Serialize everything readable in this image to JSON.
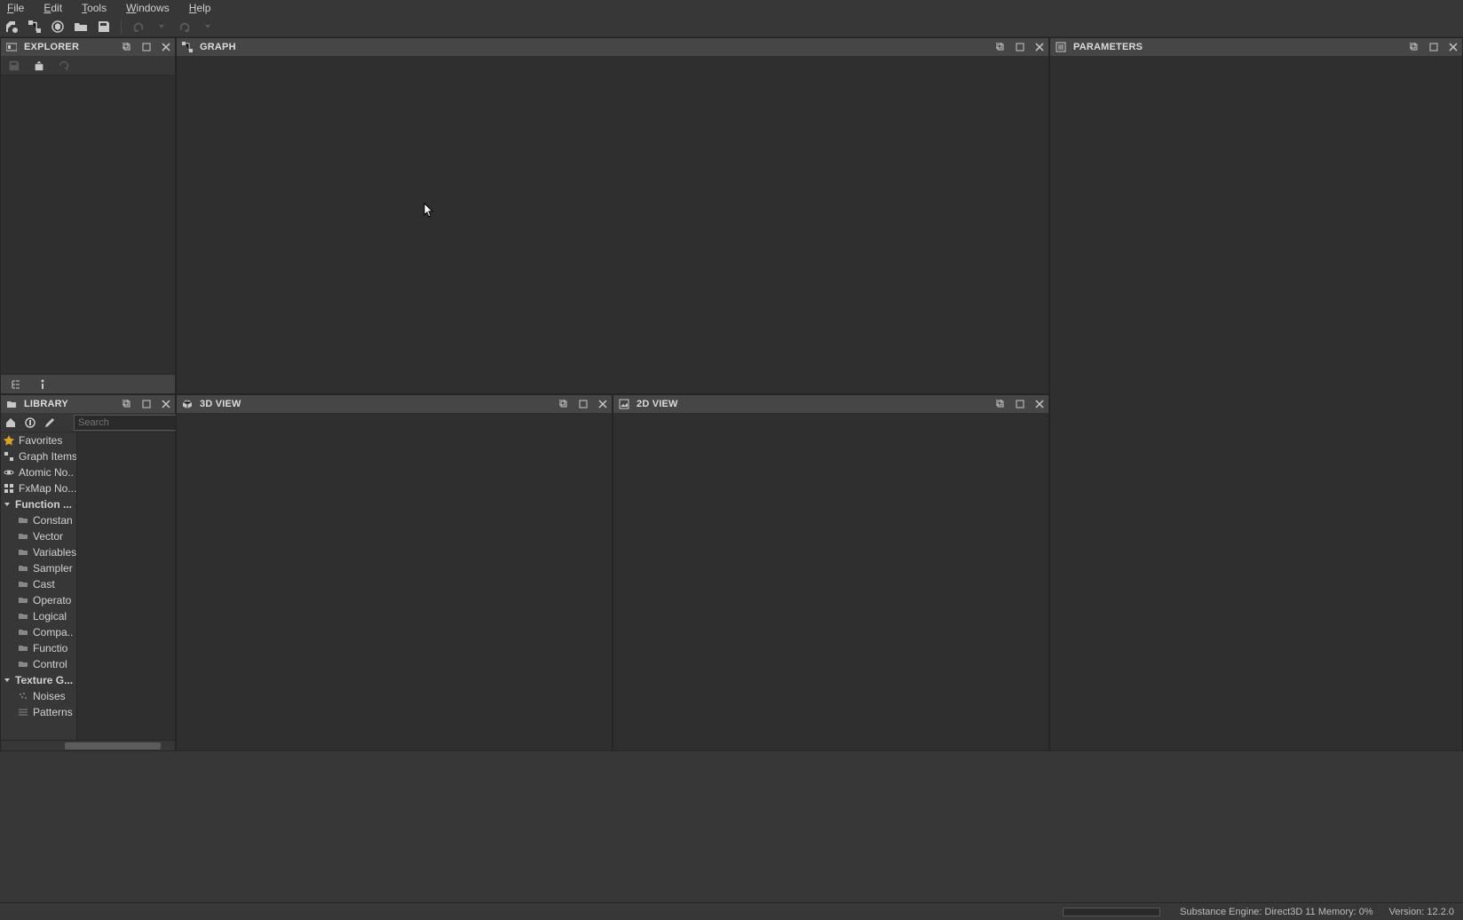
{
  "menubar": {
    "file": "File",
    "edit": "Edit",
    "tools": "Tools",
    "windows": "Windows",
    "help": "Help"
  },
  "panels": {
    "explorer": "EXPLORER",
    "graph": "GRAPH",
    "parameters": "PARAMETERS",
    "library": "LIBRARY",
    "view3d": "3D VIEW",
    "view2d": "2D VIEW"
  },
  "library": {
    "search_placeholder": "Search",
    "categories": {
      "favorites": "Favorites",
      "graph_items": "Graph Items",
      "atomic_nodes": "Atomic No..",
      "fxmap_nodes": "FxMap No...",
      "function": "Function ...",
      "function_children": {
        "constant": "Constan",
        "vector": "Vector",
        "variables": "Variables",
        "samplers": "Sampler",
        "cast": "Cast",
        "operators": "Operato",
        "logical": "Logical",
        "comparison": "Compa..",
        "function_fn": "Functio",
        "control": "Control"
      },
      "texture_gen": "Texture G...",
      "texture_children": {
        "noises": "Noises",
        "patterns": "Patterns"
      }
    }
  },
  "status": {
    "engine": "Substance Engine: Direct3D 11  Memory: 0%",
    "version": "Version: 12.2.0"
  }
}
